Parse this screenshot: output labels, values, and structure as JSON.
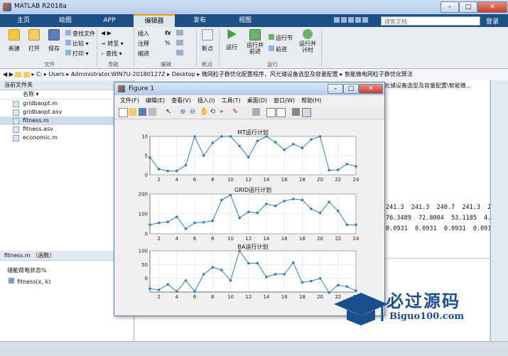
{
  "app": {
    "title": "MATLAB R2018a",
    "minimize": "–",
    "maximize": "□",
    "close": "✕"
  },
  "tabs": [
    {
      "label": "主页"
    },
    {
      "label": "绘图"
    },
    {
      "label": "APP"
    },
    {
      "label": "编辑器"
    },
    {
      "label": "发布"
    },
    {
      "label": "视图"
    }
  ],
  "search": {
    "placeholder": "搜索文档"
  },
  "login": "登录",
  "ribbon": {
    "new": "新建",
    "open": "打开",
    "save": "保存",
    "find_files": "查找文件",
    "compare": "比较",
    "print": "打印",
    "goto": "转至",
    "find": "查找",
    "insert": "插入",
    "fx": "fx",
    "comment": "注释",
    "percent": "%",
    "indent": "缩进",
    "breakpoints": "断点",
    "run": "运行",
    "run_advance": "运行并\n前进",
    "run_section": "运行节",
    "advance": "前进",
    "run_time": "运行并\n计时",
    "groups": {
      "file": "文件",
      "navigate": "导航",
      "edit": "编辑",
      "breakpoints": "断点",
      "run": "运行"
    }
  },
  "address": {
    "parts": [
      "C:",
      "Users",
      "Administrator.WIN7U-20180127Z",
      "Desktop",
      "微网粒子群优化配置程序，风光储设备选型及容量配置",
      "智能微电网粒子群优化算法"
    ]
  },
  "left_panel": {
    "title": "当前文件夹",
    "column": "名称",
    "files": [
      {
        "name": "gridbaopt.m",
        "selected": false
      },
      {
        "name": "gridbaopt.asv",
        "selected": false
      },
      {
        "name": "fitness.m",
        "selected": true
      },
      {
        "name": "fitness.asv",
        "selected": false
      },
      {
        "name": "economic.m",
        "selected": false
      }
    ],
    "detail_title": "fitness.m （函数）",
    "detail_desc": "储能荷电状态%",
    "detail_func": "fitness(x, k)"
  },
  "command_window": {
    "lines": [
      "241.3  241.3  240.7  241.3  240.",
      "76.3489  72.8004  53.1185  4.62",
      "0.0931  0.0931  0.0931  0.0931"
    ],
    "header_fragment": "光储设备选型及容量配置\\智能微..."
  },
  "figure": {
    "title": "Figure 1",
    "menu": [
      "文件(F)",
      "编辑(E)",
      "查看(V)",
      "插入(I)",
      "工具(T)",
      "桌面(D)",
      "窗口(W)",
      "帮助(H)"
    ]
  },
  "watermark": {
    "brand": "必过源码",
    "url": "Biguo100.com"
  },
  "chart_data": [
    {
      "type": "line",
      "title": "MT运行计划",
      "x": [
        1,
        2,
        3,
        4,
        5,
        6,
        7,
        8,
        9,
        10,
        11,
        12,
        13,
        14,
        15,
        16,
        17,
        18,
        19,
        20,
        21,
        22,
        23,
        24
      ],
      "values": [
        4.5,
        1.5,
        1,
        1,
        2.5,
        10,
        5,
        8.3,
        10,
        10,
        7.5,
        4.6,
        8.8,
        10,
        8.5,
        6.5,
        8,
        7,
        9.2,
        10,
        1.2,
        1.3,
        2.8,
        2.2
      ],
      "ylim": [
        0,
        10
      ],
      "yticks": [
        0,
        5,
        10
      ],
      "xticks": [
        2,
        4,
        6,
        8,
        10,
        12,
        14,
        16,
        18,
        20,
        22,
        24
      ],
      "grid": true
    },
    {
      "type": "line",
      "title": "GRID运行计划",
      "x": [
        1,
        2,
        3,
        4,
        5,
        6,
        7,
        8,
        9,
        10,
        11,
        12,
        13,
        14,
        15,
        16,
        17,
        18,
        19,
        20,
        21,
        22,
        23,
        24
      ],
      "values": [
        45,
        55,
        60,
        85,
        25,
        55,
        58,
        65,
        170,
        195,
        80,
        110,
        105,
        150,
        140,
        165,
        175,
        170,
        125,
        105,
        160,
        115,
        45,
        45
      ],
      "ylim": [
        0,
        200
      ],
      "yticks": [
        0,
        100,
        200
      ],
      "xticks": [
        2,
        4,
        6,
        8,
        10,
        12,
        14,
        16,
        18,
        20,
        22,
        24
      ],
      "grid": true
    },
    {
      "type": "line",
      "title": "BA运行计划",
      "x": [
        1,
        2,
        3,
        4,
        5,
        6,
        7,
        8,
        9,
        10,
        11,
        12,
        13,
        14,
        15,
        16,
        17,
        18,
        19,
        20,
        21,
        22,
        23,
        24
      ],
      "values": [
        -38,
        -42,
        -22,
        -48,
        -8,
        -48,
        15,
        40,
        30,
        -8,
        100,
        55,
        55,
        5,
        15,
        15,
        57,
        -15,
        -10,
        0,
        -52,
        -25,
        -30,
        -45
      ],
      "ylim": [
        -50,
        100
      ],
      "yticks": [
        0,
        50,
        100
      ],
      "xticks": [
        2,
        4,
        6,
        8,
        10,
        12,
        14,
        16,
        18,
        20,
        22,
        24
      ],
      "grid": true
    }
  ],
  "colors": {
    "line": "#2e7fc1",
    "tabbar": "#1e4f86",
    "accent": "#f39c12"
  }
}
